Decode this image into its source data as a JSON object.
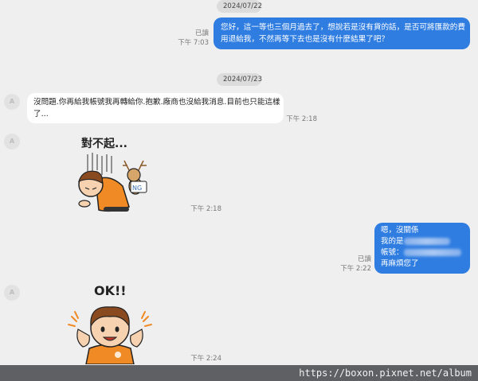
{
  "dates": {
    "first": "2024/07/22",
    "second": "2024/07/23"
  },
  "messages": {
    "m1": {
      "line1": "您好，這一等也三個月過去了，想說若是沒有貨的話，是否可將匯款的費",
      "line2": "用退給我，不然再等下去也是沒有什麼結果了吧？",
      "read": "已讀",
      "time": "下午 7:03"
    },
    "m2": {
      "line1": "沒問題.你再給我帳號我再轉給你.抱歉.廠商也沒給我消息.目前也只能這樣",
      "line2": "了...",
      "time": "下午 2:18"
    },
    "m3": {
      "sticker_text": "對不起...",
      "badge": "NG",
      "time": "下午 2:18"
    },
    "m4": {
      "line1": "嗯，沒關係",
      "line2_prefix": "我的是",
      "line3_prefix": "帳號：",
      "line4": "再麻煩您了",
      "read": "已讀",
      "time": "下午 2:22"
    },
    "m5": {
      "sticker_text": "OK!!",
      "time": "下午 2:24"
    }
  },
  "avatar_letter": "A",
  "watermark": "https://boxon.pixnet.net/album",
  "colors": {
    "outgoing": "#2f7de1",
    "incoming": "#ffffff",
    "background": "#efefef"
  }
}
